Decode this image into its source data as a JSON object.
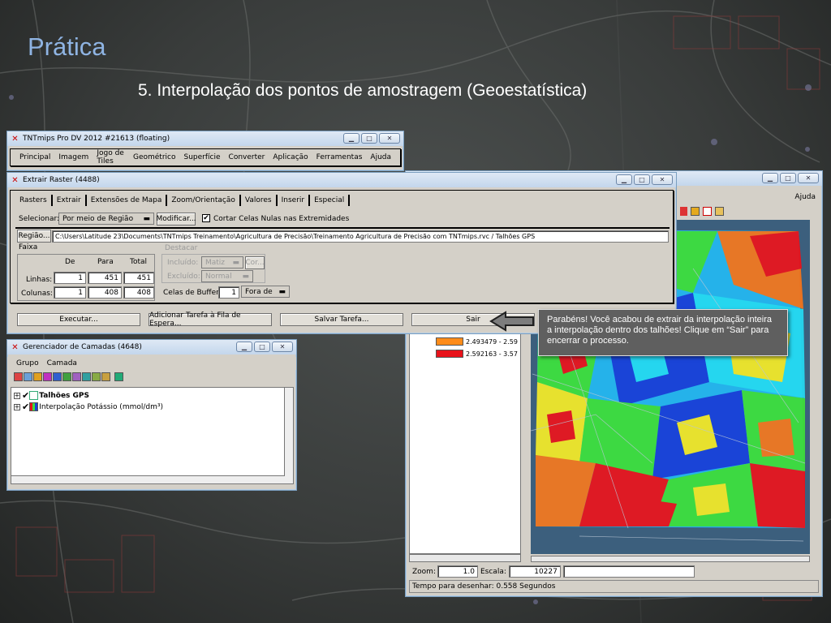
{
  "slide": {
    "title": "Prática",
    "subtitle": "5. Interpolação dos pontos de amostragem (Geoestatística)"
  },
  "main_window": {
    "title": "TNTmips Pro DV 2012  #21613 (floating)",
    "menu": [
      "Principal",
      "Imagem",
      "Jogo de Tiles",
      "Geométrico",
      "Superfície",
      "Converter",
      "Aplicação",
      "Ferramentas",
      "Ajuda"
    ]
  },
  "extract_window": {
    "title": "Extrair Raster (4488)",
    "tabs": [
      "Rasters",
      "Extrair",
      "Extensões de Mapa",
      "Zoom/Orientação",
      "Valores",
      "Inserir",
      "Especial"
    ],
    "select_label": "Selecionar:",
    "select_value": "Por meio de Região",
    "modify_button": "Modificar...",
    "clip_checkbox_label": "Cortar Celas Nulas nas Extremidades",
    "region_button": "Região...",
    "region_path": "C:\\Users\\Latitude 23\\Documents\\TNTmips Treinamento\\Agricultura de Precisão\\Treinamento Agricultura de Precisão com TNTmips.rvc / Talhões GPS",
    "range_group": "Faixa",
    "col_headers": [
      "De",
      "Para",
      "Total"
    ],
    "rows": [
      {
        "label": "Linhas:",
        "de": "1",
        "para": "451",
        "total": "451"
      },
      {
        "label": "Colunas:",
        "de": "1",
        "para": "408",
        "total": "408"
      }
    ],
    "highlight_group": "Destacar",
    "included_label": "Incluído:",
    "included_value": "Matiz",
    "color_button": "Cor...",
    "excluded_label": "Excluído:",
    "excluded_value": "Normal",
    "buffer_label": "Celas de Buffer",
    "buffer_value": "1",
    "buffer_mode": "Fora de",
    "buttons": [
      "Executar...",
      "Adicionar Tarefa à Fila de Espera...",
      "Salvar Tarefa...",
      "Sair"
    ]
  },
  "layer_window": {
    "title": "Gerenciador de Camadas  (4648)",
    "menu": [
      "Grupo",
      "Camada"
    ],
    "layers": [
      {
        "name": "Talhões GPS",
        "bold": true
      },
      {
        "name": "Interpolação Potássio (mmol/dm³)",
        "bold": false
      }
    ]
  },
  "view_window": {
    "menu_help": "Ajuda",
    "legend": [
      {
        "range": "2.493479 - 2.59",
        "color": "#ff8c1a"
      },
      {
        "range": "2.592163 - 3.57",
        "color": "#e8121a"
      }
    ],
    "zoom_label": "Zoom:",
    "zoom_value": "1.0",
    "scale_label": "Escala:",
    "scale_value": "10227",
    "status": "Tempo para desenhar: 0.558 Segundos"
  },
  "callout": {
    "text": "Parabéns! Você acabou de extrair da interpolação inteira a interpolação dentro dos talhões! Clique em “Sair” para encerrar o processo."
  },
  "colors": {
    "title": "#8fb4e3",
    "raster_blue": "#1a3fd6",
    "raster_cyan": "#25d8f0",
    "raster_green": "#3fdc3a",
    "raster_yellow": "#f2e424",
    "raster_red": "#e8121a"
  }
}
